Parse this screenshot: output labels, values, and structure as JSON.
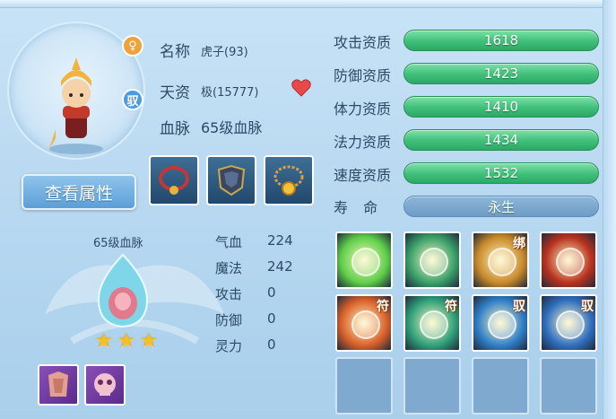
{
  "pet": {
    "name_label": "名称",
    "name_value": "虎子(93)",
    "talent_label": "天资",
    "talent_value": "极(15777)",
    "bloodline_label": "血脉",
    "bloodline_value": "65级血脉",
    "gender_badge": "♀",
    "bind_badge": "驭",
    "view_button": "查看属性"
  },
  "equipment": [
    "necklace-icon",
    "armor-icon",
    "amulet-icon"
  ],
  "bloodline_panel": {
    "title": "65级血脉",
    "stars": 3,
    "stats": [
      {
        "label": "气血",
        "value": "224"
      },
      {
        "label": "魔法",
        "value": "242"
      },
      {
        "label": "攻击",
        "value": "0"
      },
      {
        "label": "防御",
        "value": "0"
      },
      {
        "label": "灵力",
        "value": "0"
      }
    ]
  },
  "items": [
    "body-armor-icon",
    "skull-item-icon"
  ],
  "aptitudes": [
    {
      "label": "攻击资质",
      "value": "1618"
    },
    {
      "label": "防御资质",
      "value": "1423"
    },
    {
      "label": "体力资质",
      "value": "1410"
    },
    {
      "label": "法力资质",
      "value": "1434"
    },
    {
      "label": "速度资质",
      "value": "1532"
    }
  ],
  "life": {
    "label": "寿 命",
    "value": "永生"
  },
  "skills": [
    {
      "icon": "heart-shield-icon",
      "tag": "",
      "color": "#5fcf4a"
    },
    {
      "icon": "lightning-slash-icon",
      "tag": "",
      "color": "#3aa06a"
    },
    {
      "icon": "fist-icon",
      "tag": "绑",
      "color": "#c98a2b"
    },
    {
      "icon": "demon-icon",
      "tag": "",
      "color": "#b8321e"
    },
    {
      "icon": "warrior-icon",
      "tag": "符",
      "color": "#d9602a"
    },
    {
      "icon": "runner-icon",
      "tag": "符",
      "color": "#2fa07a"
    },
    {
      "icon": "wind-orb-icon",
      "tag": "驭",
      "color": "#2f7fc8"
    },
    {
      "icon": "wave-fist-icon",
      "tag": "驭",
      "color": "#2f6fc0"
    }
  ]
}
